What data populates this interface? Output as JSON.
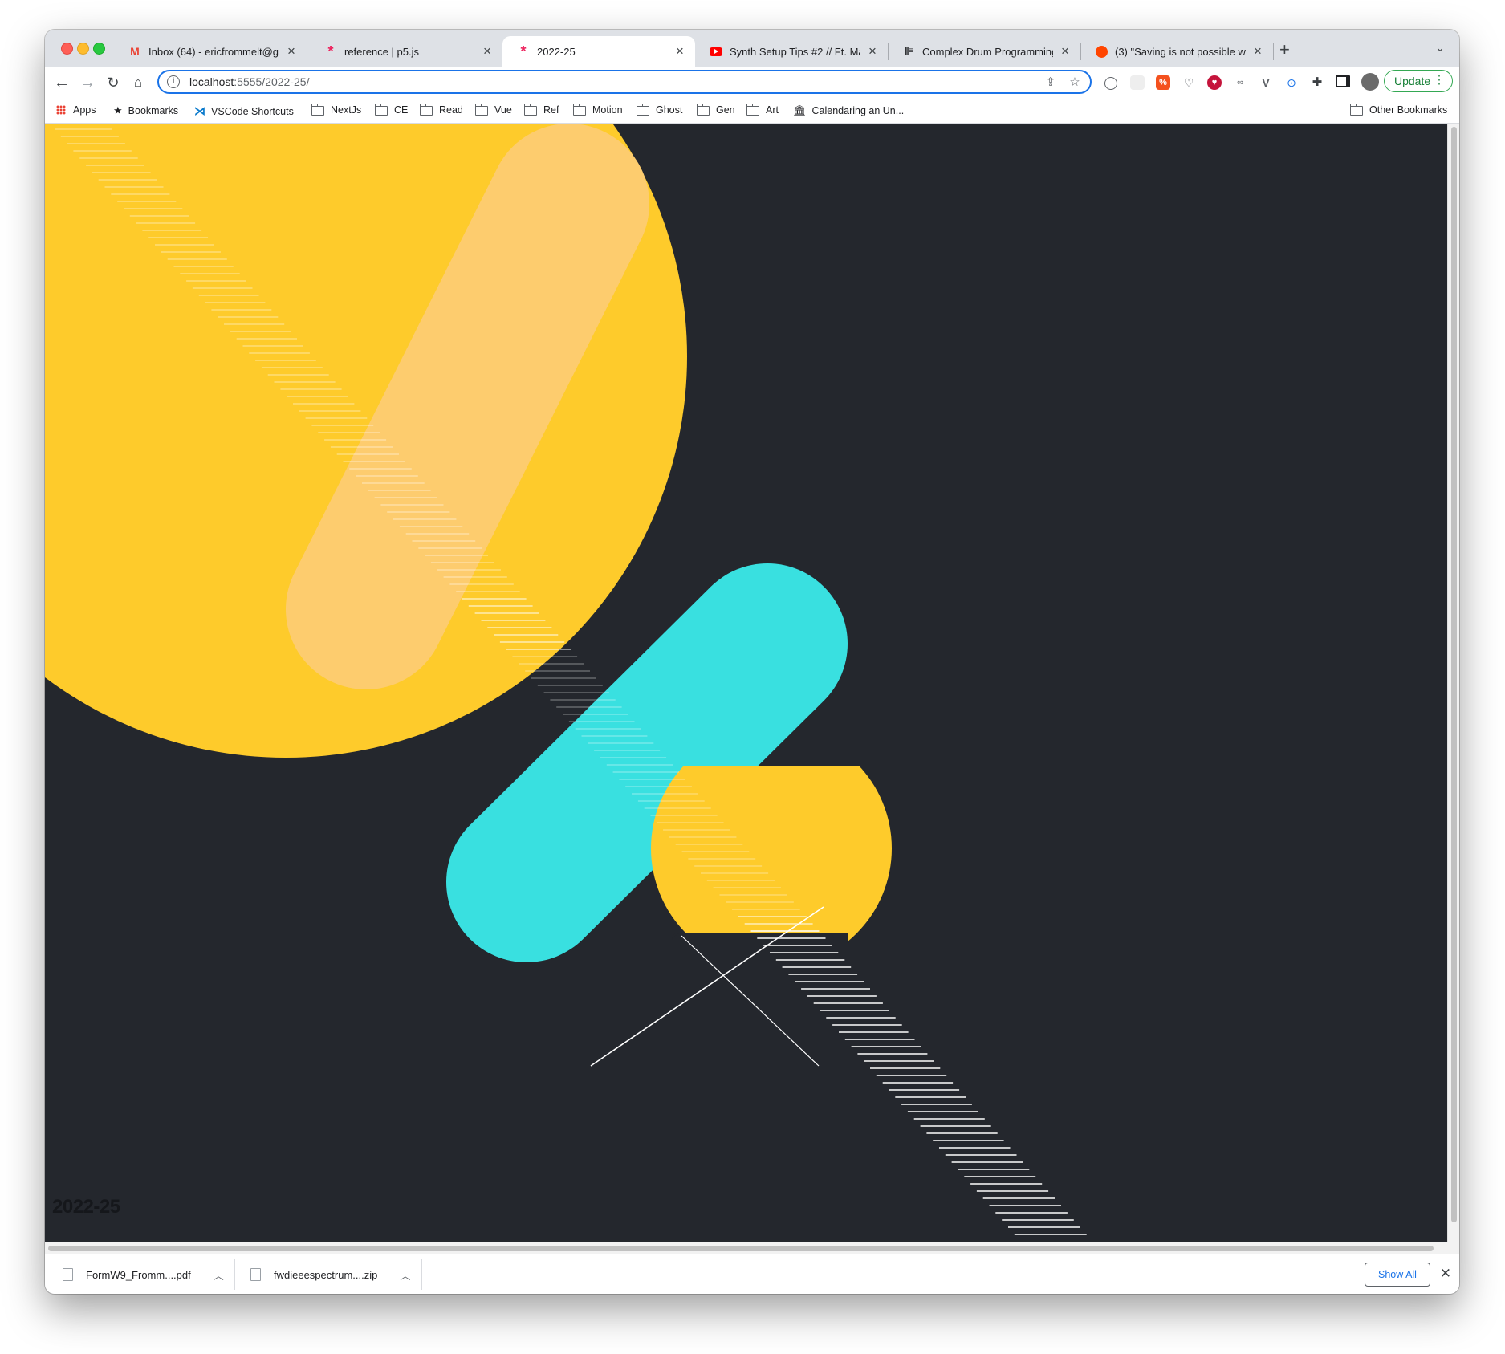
{
  "browser": {
    "tabs": [
      {
        "title": "Inbox (64) - ericfrommelt@gm",
        "icon": "gmail-icon",
        "active": false
      },
      {
        "title": "reference | p5.js",
        "icon": "p5js-icon",
        "active": false
      },
      {
        "title": "2022-25",
        "icon": "p5js-icon",
        "active": true
      },
      {
        "title": "Synth Setup Tips #2 // Ft. Mart",
        "icon": "youtube-icon",
        "active": false
      },
      {
        "title": "Complex Drum Programming w",
        "icon": "elektron-icon",
        "active": false
      },
      {
        "title": "(3) \"Saving is not possible whi",
        "icon": "reddit-icon",
        "active": false
      }
    ],
    "address": {
      "host": "localhost",
      "rest": ":5555/2022-25/"
    },
    "update_label": "Update",
    "bookmarks": [
      {
        "label": "Apps",
        "icon": "apps-grid-icon"
      },
      {
        "label": "Bookmarks",
        "icon": "star-icon"
      },
      {
        "label": "VSCode Shortcuts",
        "icon": "vscode-icon"
      },
      {
        "label": "NextJs",
        "icon": "folder-icon"
      },
      {
        "label": "CE",
        "icon": "folder-icon"
      },
      {
        "label": "Read",
        "icon": "folder-icon"
      },
      {
        "label": "Vue",
        "icon": "folder-icon"
      },
      {
        "label": "Ref",
        "icon": "folder-icon"
      },
      {
        "label": "Motion",
        "icon": "folder-icon"
      },
      {
        "label": "Ghost",
        "icon": "folder-icon"
      },
      {
        "label": "Gen",
        "icon": "folder-icon"
      },
      {
        "label": "Art",
        "icon": "folder-icon"
      },
      {
        "label": "Calendaring an Un...",
        "icon": "museum-icon"
      }
    ],
    "other_bookmarks": "Other Bookmarks"
  },
  "page": {
    "label": "2022-25",
    "colors": {
      "background": "#24272d",
      "yellow": "#fecb2b",
      "light_orange": "#fdcc6e",
      "cyan": "#39e0e0",
      "white": "#ffffff"
    }
  },
  "downloads": {
    "items": [
      {
        "name": "FormW9_Fromm....pdf"
      },
      {
        "name": "fwdieeespectrum....zip"
      }
    ],
    "show_all": "Show All"
  }
}
